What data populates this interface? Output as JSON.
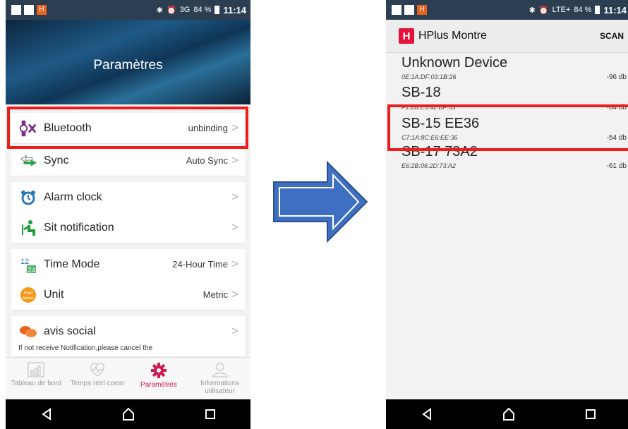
{
  "status_bar": {
    "left_time": "11:14",
    "left_signal": "3G",
    "battery": "84 %",
    "right_time": "11:14",
    "right_signal": "LTE+",
    "right_battery": "84 %",
    "badge_letter": "H"
  },
  "settings": {
    "title": "Paramètres",
    "rows": [
      {
        "label": "Bluetooth",
        "value": "unbinding"
      },
      {
        "label": "Sync",
        "value": "Auto Sync"
      },
      {
        "label": "Alarm clock",
        "value": ""
      },
      {
        "label": "Sit notification",
        "value": ""
      },
      {
        "label": "Time Mode",
        "value": "24-Hour Time"
      },
      {
        "label": "Unit",
        "value": "Metric"
      },
      {
        "label": "avis social",
        "value": ""
      }
    ],
    "partial_note": "If not receive Notification,please cancel the",
    "time_mode_icon_text": "12 24",
    "unit_icon_text": "Feet Meters",
    "chevron": ">"
  },
  "tabs": [
    {
      "label": "Tableau de bord"
    },
    {
      "label": "Temps réel coear"
    },
    {
      "label": "Paramètres"
    },
    {
      "label": "Informations utilisateur"
    }
  ],
  "scanner": {
    "app_name": "HPlus Montre",
    "logo_letter": "H",
    "scan_label": "SCAN",
    "devices": [
      {
        "name": "Unknown Device",
        "address": "0E:1A:DF:03:1B:26",
        "rssi": "-96 db"
      },
      {
        "name": "SB-18",
        "address": "F1:2B:E3:42:BF:33",
        "rssi": "-84 db"
      },
      {
        "name": "SB-15 EE36",
        "address": "C7:1A:8C:E6:EE:36",
        "rssi": "-54 db"
      },
      {
        "name": "SB-17 73A2",
        "address": "E6:2B:06:2D:73:A2",
        "rssi": "-61 db"
      }
    ]
  },
  "colors": {
    "highlight": "#ef1c1c",
    "arrow_fill": "#3e6fc0",
    "active_tab": "#cc1b4f",
    "status_bar": "#2c3f52"
  }
}
